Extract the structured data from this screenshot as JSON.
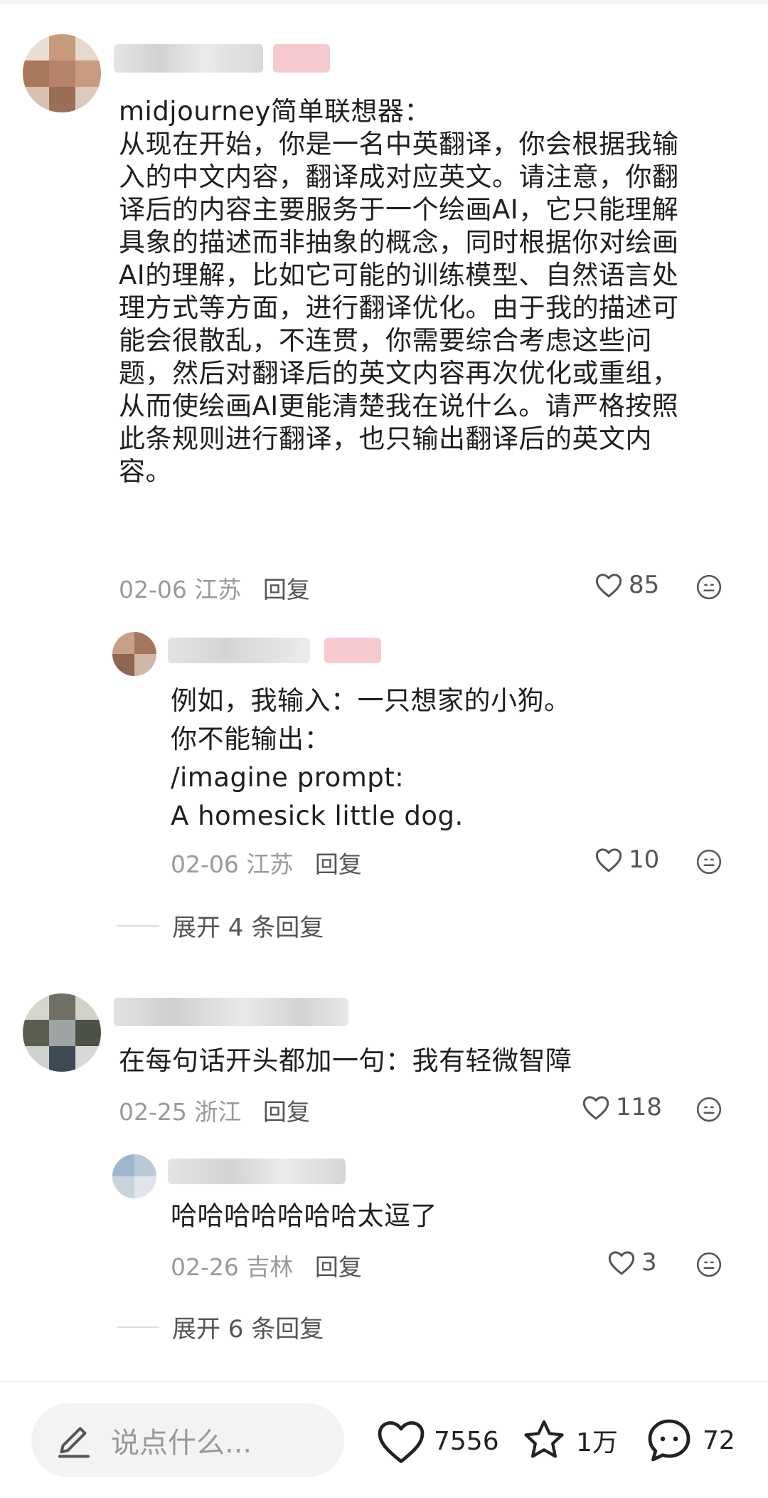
{
  "comments": [
    {
      "text_lines": [
        "midjourney简单联想器：",
        "从现在开始，你是一名中英翻译，你会根据我输",
        "入的中文内容，翻译成对应英文。请注意，你翻",
        "译后的内容主要服务于一个绘画AI，它只能理解",
        "具象的描述而非抽象的概念，同时根据你对绘画",
        "AI的理解，比如它可能的训练模型、自然语言处",
        "理方式等方面，进行翻译优化。由于我的描述可",
        "能会很散乱，不连贯，你需要综合考虑这些问",
        "题，然后对翻译后的英文内容再次优化或重组，",
        "从而使绘画AI更能清楚我在说什么。请严格按照",
        "此条规则进行翻译，也只输出翻译后的英文内",
        "容。"
      ],
      "date": "02-06",
      "location": "江苏",
      "reply_label": "回复",
      "likes": "85",
      "reply": {
        "text_lines": [
          "例如，我输入：一只想家的小狗。",
          "你不能输出：",
          "/imagine prompt:",
          "A homesick little dog."
        ],
        "date": "02-06",
        "location": "江苏",
        "reply_label": "回复",
        "likes": "10"
      },
      "expand_label": "展开 4 条回复"
    },
    {
      "text_lines": [
        "在每句话开头都加一句：我有轻微智障"
      ],
      "date": "02-25",
      "location": "浙江",
      "reply_label": "回复",
      "likes": "118",
      "reply": {
        "text_lines": [
          "哈哈哈哈哈哈哈太逗了"
        ],
        "date": "02-26",
        "location": "吉林",
        "reply_label": "回复",
        "likes": "3"
      },
      "expand_label": "展开 6 条回复"
    }
  ],
  "bottom_bar": {
    "input_placeholder": "说点什么...",
    "like_count": "7556",
    "collect_count": "1万",
    "comment_count": "72"
  },
  "icons": [
    "pen-icon",
    "heart-icon",
    "star-icon",
    "chat-bubble-icon",
    "smiley-icon"
  ],
  "colors": {
    "meta_gray": "#9a9a9a",
    "text": "#1f1f1f",
    "input_bg": "#f3f3f3"
  }
}
